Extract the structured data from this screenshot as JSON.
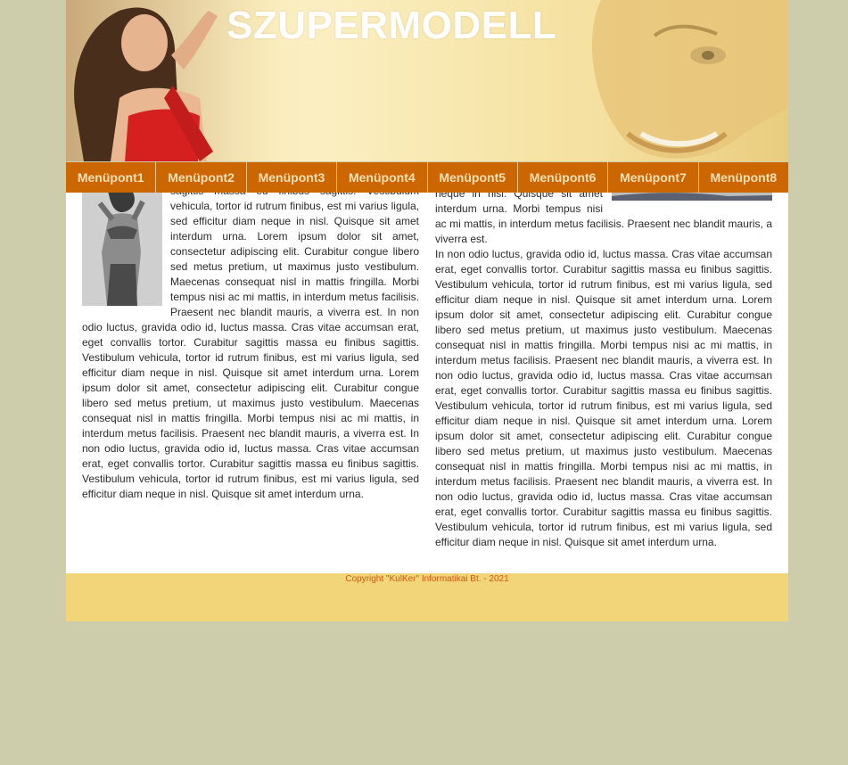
{
  "header": {
    "title": "SZUPERMODELL"
  },
  "nav": {
    "items": [
      "Menüpont1",
      "Menüpont2",
      "Menüpont3",
      "Menüpont4",
      "Menüpont5",
      "Menüpont6",
      "Menüpont7",
      "Menüpont8"
    ]
  },
  "content": {
    "left_top": "sagittis massa eu finibus sagittis. Vestibulum vehicula, tortor id rutrum finibus, est mi varius ligula, sed efficitur diam neque in nisl. Quisque sit amet interdum urna. Lorem ipsum dolor sit amet, consectetur adipiscing elit. Curabitur congue libero sed metus pretium, ut maximus justo vestibulum. Maecenas consequat nisl in mattis fringilla. Morbi tempus nisi ac mi mattis, in interdum metus facilisis. Praesent nec blandit mauris, a viverra est. In non odio luctus, gravida odio id, luctus massa. Cras vitae accumsan erat, eget convallis tortor. Curabitur sagittis massa eu finibus sagittis. Vestibulum vehicula, tortor id rutrum finibus, est mi varius ligula, sed efficitur diam neque in nisl. Quisque sit amet interdum urna. Lorem ipsum dolor sit amet, consectetur adipiscing elit. Curabitur congue libero sed metus pretium, ut maximus justo vestibulum. Maecenas consequat nisl in mattis fringilla. Morbi tempus nisi ac mi mattis, in interdum metus facilisis. Praesent nec blandit mauris, a viverra est. In non odio luctus, gravida odio id, luctus massa. Cras vitae accumsan erat, eget convallis tortor. Curabitur sagittis massa eu finibus sagittis. Vestibulum vehicula, tortor id rutrum finibus, est mi varius ligula, sed efficitur diam neque in nisl. Quisque sit amet interdum urna.",
    "right_top": "tortor id rutrum finibus, est mi varius ligula, sed efficitur diam neque in nisl. Quisque sit amet interdum urna. Morbi tempus nisi ac mi mattis, in interdum metus facilisis. Praesent nec blandit mauris, a viverra est.",
    "right_body": "In non odio luctus, gravida odio id, luctus massa. Cras vitae accumsan erat, eget convallis tortor. Curabitur sagittis massa eu finibus sagittis. Vestibulum vehicula, tortor id rutrum finibus, est mi varius ligula, sed efficitur diam neque in nisl. Quisque sit amet interdum urna. Lorem ipsum dolor sit amet, consectetur adipiscing elit. Curabitur congue libero sed metus pretium, ut maximus justo vestibulum. Maecenas consequat nisl in mattis fringilla. Morbi tempus nisi ac mi mattis, in interdum metus facilisis. Praesent nec blandit mauris, a viverra est. In non odio luctus, gravida odio id, luctus massa. Cras vitae accumsan erat, eget convallis tortor. Curabitur sagittis massa eu finibus sagittis. Vestibulum vehicula, tortor id rutrum finibus, est mi varius ligula, sed efficitur diam neque in nisl. Quisque sit amet interdum urna. Lorem ipsum dolor sit amet, consectetur adipiscing elit. Curabitur congue libero sed metus pretium, ut maximus justo vestibulum. Maecenas consequat nisl in mattis fringilla. Morbi tempus nisi ac mi mattis, in interdum metus facilisis. Praesent nec blandit mauris, a viverra est. In non odio luctus, gravida odio id, luctus massa. Cras vitae accumsan erat, eget convallis tortor. Curabitur sagittis massa eu finibus sagittis. Vestibulum vehicula, tortor id rutrum finibus, est mi varius ligula, sed efficitur diam neque in nisl. Quisque sit amet interdum urna."
  },
  "footer": {
    "copyright": "Copyright \"KulKer\" Informatikai Bt. - 2021"
  },
  "colors": {
    "background": "#cdcdab",
    "nav": "#cc6600",
    "header": "#f6e4a6",
    "footer": "#f3d579",
    "footer_text": "#cc5a10"
  }
}
